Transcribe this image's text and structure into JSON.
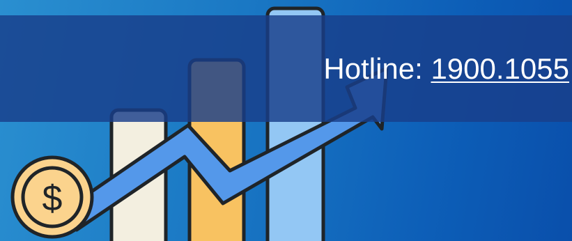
{
  "hotline": {
    "label": "Hotline:",
    "number": "1900.1055"
  },
  "illustration": {
    "icons": [
      "bar-chart-icon",
      "growth-arrow-icon",
      "dollar-coin-icon"
    ],
    "coin_symbol": "$",
    "colors": {
      "bar_cream": "#f3efe0",
      "bar_orange": "#f8c261",
      "bar_light_blue": "#93c7f4",
      "arrow": "#5498ea",
      "coin": "#fbd38d",
      "outline": "#1f2428"
    }
  }
}
